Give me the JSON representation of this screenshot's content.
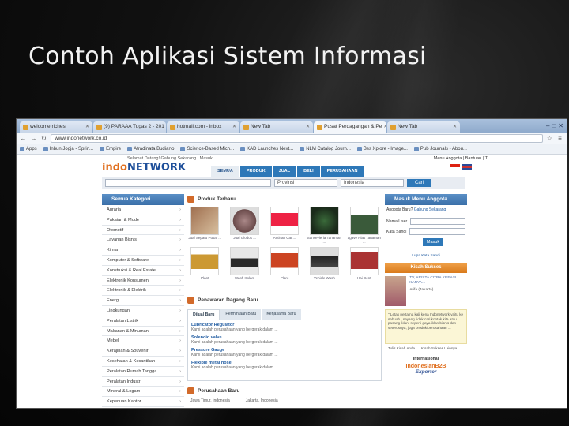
{
  "slide": {
    "title": "Contoh Aplikasi Sistem Informasi"
  },
  "browser": {
    "tabs": [
      {
        "label": "welcome riches",
        "active": false
      },
      {
        "label": "(9) PARAAA Tugas 2 - 201",
        "active": false
      },
      {
        "label": "hotmail.com - inbox",
        "active": false
      },
      {
        "label": "New Tab",
        "active": false
      },
      {
        "label": "Pusat Perdagangan & Pe",
        "active": true
      },
      {
        "label": "New Tab",
        "active": false
      }
    ],
    "url": "www.indonetwork.co.id",
    "bookmarks": [
      "Apps",
      "Inbun Jogja - Sprin...",
      "Empire",
      "Atradinata Budiarto",
      "Science-Based Mich...",
      "KAD Launches Next...",
      "NLM Catalog Journ...",
      "Bss Xplore - Image...",
      "Pub Journals - Abou..."
    ]
  },
  "site": {
    "welcome": "Selamat Datang! Gabung Sekarang | Masuk",
    "top_right": "Menu Anggota | Bantuan | T",
    "logo_a": "indo",
    "logo_b": "NETWORK",
    "nav": [
      "SEMUA",
      "PRODUK",
      "JUAL",
      "BELI",
      "PERUSAHAAN"
    ],
    "search": {
      "category": "Provinsi",
      "region": "Indonesia",
      "button": "Cari"
    },
    "categories_title": "Semua Kategori",
    "categories": [
      "Agraria",
      "Pakaian & Mode",
      "Otomotif",
      "Layanan Bisnis",
      "Kimia",
      "Komputer & Software",
      "Konstruksi & Real Estate",
      "Elektronik Konsumen",
      "Elektronik & Elektrik",
      "Energi",
      "Lingkungan",
      "Peralatan Listrik",
      "Makanan & Minuman",
      "Mebel",
      "Kerajinan & Souvenir",
      "Kesehatan & Kecantikan",
      "Peralatan Rumah Tangga",
      "Peralatan Industri",
      "Mineral & Logam",
      "Keperluan Kantor"
    ],
    "products_title": "Produk Terbaru",
    "products": [
      "Jual Sepatu Pusat ...",
      "Jual Glodok ...",
      "Antinan Cat ...",
      "Sansevieria Tanaman ...",
      "agave Hias Tanaman ...",
      "Plant",
      "Wash Kolam",
      "Plant",
      "Vehicle Wash",
      "Hai Dent"
    ],
    "tenders_title": "Penawaran Dagang Baru",
    "tender_tabs": [
      "Dijual Baru",
      "Permintaan Baru",
      "Kerjasama Baru"
    ],
    "tenders": [
      {
        "title": "Lubricator Regulator",
        "desc": "Kami adalah perusahaan yang bergerak dalam ..."
      },
      {
        "title": "Solenoid valve",
        "desc": "Kami adalah perusahaan yang bergerak dalam ..."
      },
      {
        "title": "Pressure Gauge",
        "desc": "Kami adalah perusahaan yang bergerak dalam ..."
      },
      {
        "title": "Flexible metal hose",
        "desc": "Kami adalah perusahaan yang bergerak dalam ..."
      }
    ],
    "companies_title": "Perusahaan Baru",
    "companies": [
      "Jawa Timur, Indonesia",
      "Jakarta, Indonesia"
    ],
    "login": {
      "title": "Masuk Menu Anggota",
      "note_prefix": "Anggota Baru? ",
      "note_link": "Gabung Sekarang",
      "username_label": "Nama User",
      "password_label": "Kata Sandi",
      "button": "Masuk",
      "forgot": "Lupa Kata Sandi"
    },
    "success_title": "Kisah Sukses",
    "story_text": "TV, ARISTA CITRA KREASI KARYA... ",
    "story_name": "Arifa (Jakarta)",
    "quote": "\" Letak pertama kali kena Indonetwork yaitu ke sebuah , sayang tidak cari kontak kita atau pasang iklan, seperti gaya iklan bisnis dan seterusnya, juga produk/perusahaan ... \"",
    "quote_links": [
      "Tulis Kisah Anda",
      "Kisah Sukses Lainnya"
    ],
    "intl_title": "Internasional",
    "intl_logo_a": "IndonesianB2B",
    "intl_logo_b": "Exporter"
  }
}
